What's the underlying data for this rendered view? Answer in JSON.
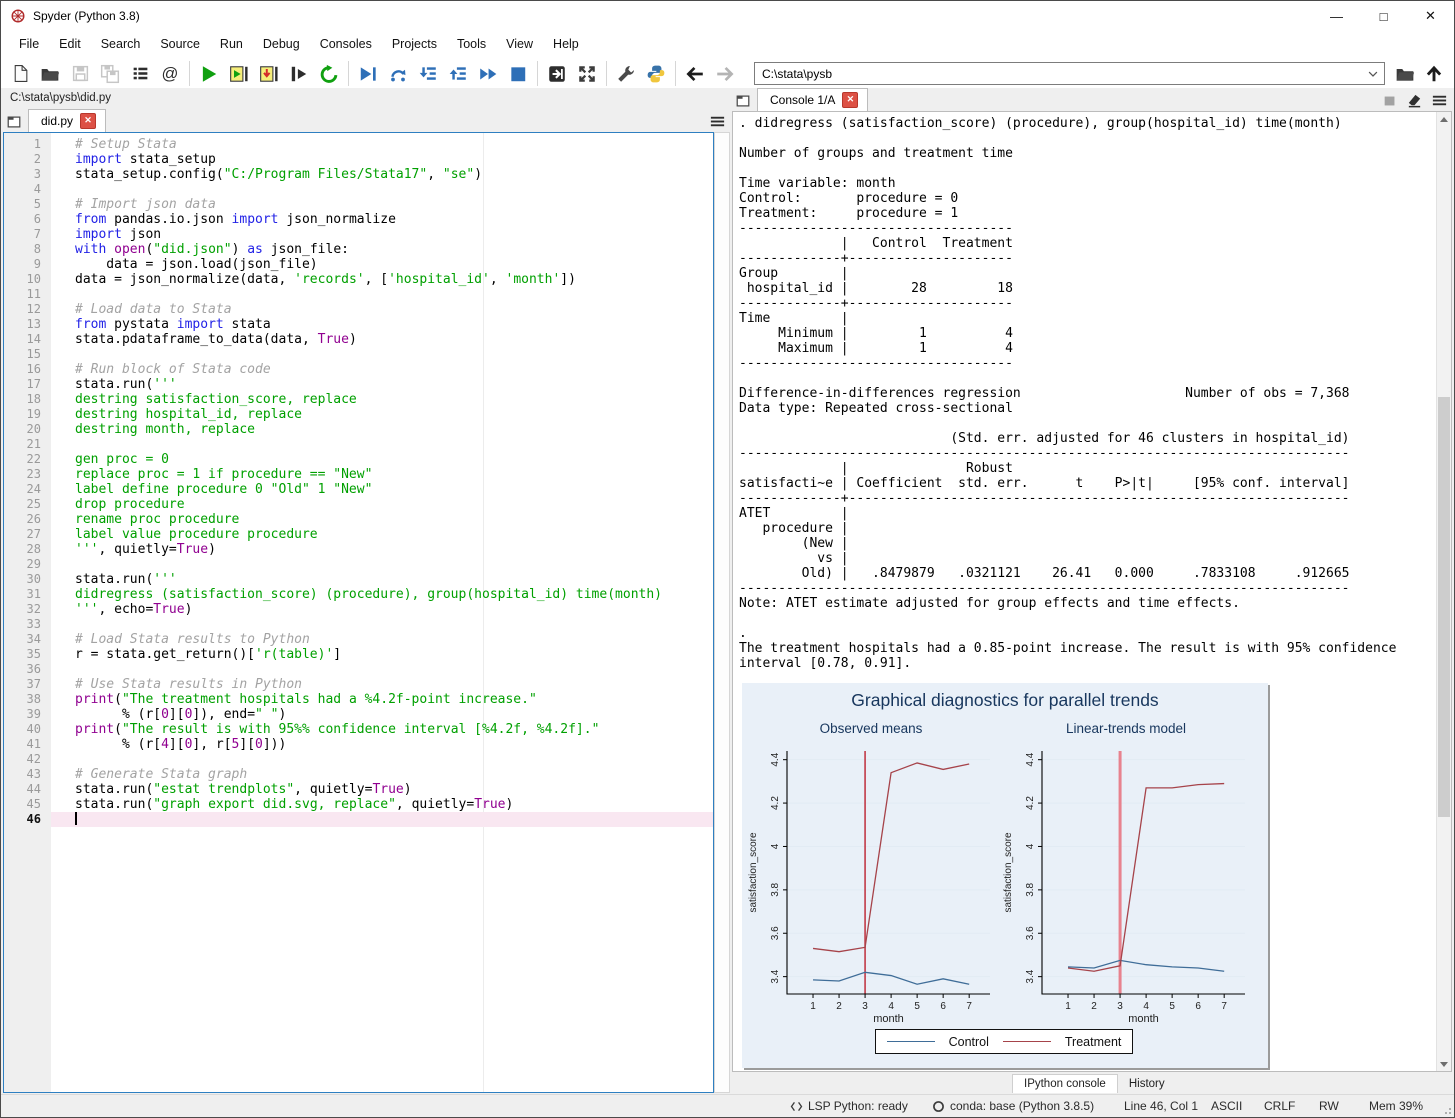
{
  "window": {
    "title": "Spyder (Python 3.8)",
    "controls": {
      "minimize": "—",
      "maximize": "□",
      "close": "✕"
    }
  },
  "menu": {
    "items": [
      "File",
      "Edit",
      "Search",
      "Source",
      "Run",
      "Debug",
      "Consoles",
      "Projects",
      "Tools",
      "View",
      "Help"
    ]
  },
  "toolbar": {
    "path_value": "C:\\stata\\pysb",
    "buttons": [
      {
        "id": "new-file"
      },
      {
        "id": "open-file"
      },
      {
        "id": "save-file",
        "enabled": false
      },
      {
        "id": "save-all",
        "enabled": false
      },
      {
        "id": "file-switcher"
      },
      {
        "id": "symbol-finder"
      },
      {
        "sep": true
      },
      {
        "id": "run-file"
      },
      {
        "id": "run-cell"
      },
      {
        "id": "run-cell-advance"
      },
      {
        "id": "run-selection"
      },
      {
        "id": "rerun-cell"
      },
      {
        "sep": true
      },
      {
        "id": "debug-file"
      },
      {
        "id": "step-over"
      },
      {
        "id": "step-into"
      },
      {
        "id": "step-return"
      },
      {
        "id": "debug-continue"
      },
      {
        "id": "stop-debug"
      },
      {
        "sep": true
      },
      {
        "id": "maximize-pane"
      },
      {
        "id": "fullscreen"
      },
      {
        "sep": true
      },
      {
        "id": "preferences"
      },
      {
        "id": "python-path"
      },
      {
        "sep": true
      },
      {
        "id": "back"
      },
      {
        "id": "forward",
        "enabled": false
      }
    ]
  },
  "editor": {
    "breadcrumb": "C:\\stata\\pysb\\did.py",
    "tab": "did.py",
    "lines": [
      {
        "n": 1,
        "tokens": [
          [
            "c",
            "# Setup Stata"
          ]
        ]
      },
      {
        "n": 2,
        "tokens": [
          [
            "k",
            "import"
          ],
          [
            "t",
            " stata_setup"
          ]
        ]
      },
      {
        "n": 3,
        "tokens": [
          [
            "t",
            "stata_setup.config("
          ],
          [
            "s",
            "\"C:/Program Files/Stata17\""
          ],
          [
            "t",
            ", "
          ],
          [
            "s",
            "\"se\""
          ],
          [
            "t",
            ")"
          ]
        ]
      },
      {
        "n": 4,
        "tokens": []
      },
      {
        "n": 5,
        "tokens": [
          [
            "c",
            "# Import json data"
          ]
        ]
      },
      {
        "n": 6,
        "tokens": [
          [
            "k",
            "from"
          ],
          [
            "t",
            " pandas.io.json "
          ],
          [
            "k",
            "import"
          ],
          [
            "t",
            " json_normalize"
          ]
        ]
      },
      {
        "n": 7,
        "tokens": [
          [
            "k",
            "import"
          ],
          [
            "t",
            " json"
          ]
        ]
      },
      {
        "n": 8,
        "tokens": [
          [
            "k",
            "with"
          ],
          [
            "t",
            " "
          ],
          [
            "m",
            "open"
          ],
          [
            "t",
            "("
          ],
          [
            "s",
            "\"did.json\""
          ],
          [
            "t",
            ") "
          ],
          [
            "k",
            "as"
          ],
          [
            "t",
            " json_file:"
          ]
        ]
      },
      {
        "n": 9,
        "tokens": [
          [
            "t",
            "    data = json.load(json_file)"
          ]
        ]
      },
      {
        "n": 10,
        "tokens": [
          [
            "t",
            "data = json_normalize(data, "
          ],
          [
            "s",
            "'records'"
          ],
          [
            "t",
            ", ["
          ],
          [
            "s",
            "'hospital_id'"
          ],
          [
            "t",
            ", "
          ],
          [
            "s",
            "'month'"
          ],
          [
            "t",
            "])"
          ]
        ]
      },
      {
        "n": 11,
        "tokens": []
      },
      {
        "n": 12,
        "tokens": [
          [
            "c",
            "# Load data to Stata"
          ]
        ]
      },
      {
        "n": 13,
        "tokens": [
          [
            "k",
            "from"
          ],
          [
            "t",
            " pystata "
          ],
          [
            "k",
            "import"
          ],
          [
            "t",
            " stata"
          ]
        ]
      },
      {
        "n": 14,
        "tokens": [
          [
            "t",
            "stata.pdataframe_to_data(data, "
          ],
          [
            "m",
            "True"
          ],
          [
            "t",
            ")"
          ]
        ]
      },
      {
        "n": 15,
        "tokens": []
      },
      {
        "n": 16,
        "tokens": [
          [
            "c",
            "# Run block of Stata code"
          ]
        ]
      },
      {
        "n": 17,
        "tokens": [
          [
            "t",
            "stata.run("
          ],
          [
            "s",
            "'''"
          ]
        ]
      },
      {
        "n": 18,
        "tokens": [
          [
            "s",
            "destring satisfaction_score, replace"
          ]
        ]
      },
      {
        "n": 19,
        "tokens": [
          [
            "s",
            "destring hospital_id, replace"
          ]
        ]
      },
      {
        "n": 20,
        "tokens": [
          [
            "s",
            "destring month, replace"
          ]
        ]
      },
      {
        "n": 21,
        "tokens": []
      },
      {
        "n": 22,
        "tokens": [
          [
            "s",
            "gen proc = 0"
          ]
        ]
      },
      {
        "n": 23,
        "tokens": [
          [
            "s",
            "replace proc = 1 if procedure == \"New\""
          ]
        ]
      },
      {
        "n": 24,
        "tokens": [
          [
            "s",
            "label define procedure 0 \"Old\" 1 \"New\""
          ]
        ]
      },
      {
        "n": 25,
        "tokens": [
          [
            "s",
            "drop procedure"
          ]
        ]
      },
      {
        "n": 26,
        "tokens": [
          [
            "s",
            "rename proc procedure"
          ]
        ]
      },
      {
        "n": 27,
        "tokens": [
          [
            "s",
            "label value procedure procedure"
          ]
        ]
      },
      {
        "n": 28,
        "tokens": [
          [
            "s",
            "'''"
          ],
          [
            "t",
            ", quietly="
          ],
          [
            "m",
            "True"
          ],
          [
            "t",
            ")"
          ]
        ]
      },
      {
        "n": 29,
        "tokens": []
      },
      {
        "n": 30,
        "tokens": [
          [
            "t",
            "stata.run("
          ],
          [
            "s",
            "'''"
          ]
        ]
      },
      {
        "n": 31,
        "tokens": [
          [
            "s",
            "didregress (satisfaction_score) (procedure), group(hospital_id) time(month)"
          ]
        ]
      },
      {
        "n": 32,
        "tokens": [
          [
            "s",
            "'''"
          ],
          [
            "t",
            ", echo="
          ],
          [
            "m",
            "True"
          ],
          [
            "t",
            ")"
          ]
        ]
      },
      {
        "n": 33,
        "tokens": []
      },
      {
        "n": 34,
        "tokens": [
          [
            "c",
            "# Load Stata results to Python"
          ]
        ]
      },
      {
        "n": 35,
        "tokens": [
          [
            "t",
            "r = stata.get_return()["
          ],
          [
            "s",
            "'r(table)'"
          ],
          [
            "t",
            "]"
          ]
        ]
      },
      {
        "n": 36,
        "tokens": []
      },
      {
        "n": 37,
        "tokens": [
          [
            "c",
            "# Use Stata results in Python"
          ]
        ]
      },
      {
        "n": 38,
        "tokens": [
          [
            "m",
            "print"
          ],
          [
            "t",
            "("
          ],
          [
            "s",
            "\"The treatment hospitals had a %4.2f-point increase.\""
          ]
        ]
      },
      {
        "n": 39,
        "tokens": [
          [
            "t",
            "      % (r["
          ],
          [
            "m",
            "0"
          ],
          [
            "t",
            "]["
          ],
          [
            "m",
            "0"
          ],
          [
            "t",
            "]), end="
          ],
          [
            "s",
            "\" \""
          ],
          [
            "t",
            ")"
          ]
        ]
      },
      {
        "n": 40,
        "tokens": [
          [
            "m",
            "print"
          ],
          [
            "t",
            "("
          ],
          [
            "s",
            "\"The result is with 95%% confidence interval [%4.2f, %4.2f].\""
          ]
        ]
      },
      {
        "n": 41,
        "tokens": [
          [
            "t",
            "      % (r["
          ],
          [
            "m",
            "4"
          ],
          [
            "t",
            "]["
          ],
          [
            "m",
            "0"
          ],
          [
            "t",
            "], r["
          ],
          [
            "m",
            "5"
          ],
          [
            "t",
            "]["
          ],
          [
            "m",
            "0"
          ],
          [
            "t",
            "]))"
          ]
        ]
      },
      {
        "n": 42,
        "tokens": []
      },
      {
        "n": 43,
        "tokens": [
          [
            "c",
            "# Generate Stata graph"
          ]
        ]
      },
      {
        "n": 44,
        "tokens": [
          [
            "t",
            "stata.run("
          ],
          [
            "s",
            "\"estat trendplots\""
          ],
          [
            "t",
            ", quietly="
          ],
          [
            "m",
            "True"
          ],
          [
            "t",
            ")"
          ]
        ]
      },
      {
        "n": 45,
        "tokens": [
          [
            "t",
            "stata.run("
          ],
          [
            "s",
            "\"graph export did.svg, replace\""
          ],
          [
            "t",
            ", quietly="
          ],
          [
            "m",
            "True"
          ],
          [
            "t",
            ")"
          ]
        ]
      },
      {
        "n": 46,
        "tokens": [],
        "active": true
      }
    ]
  },
  "console": {
    "tab": "Console 1/A",
    "lines": [
      ". didregress (satisfaction_score) (procedure), group(hospital_id) time(month)",
      "",
      "Number of groups and treatment time",
      "",
      "Time variable: month",
      "Control:       procedure = 0",
      "Treatment:     procedure = 1",
      "-----------------------------------",
      "             |   Control  Treatment",
      "-------------+---------------------",
      "Group        |",
      " hospital_id |        28         18",
      "-------------+---------------------",
      "Time         |",
      "     Minimum |         1          4",
      "     Maximum |         1          4",
      "-----------------------------------",
      "",
      "Difference-in-differences regression                     Number of obs = 7,368",
      "Data type: Repeated cross-sectional",
      "",
      "                           (Std. err. adjusted for 46 clusters in hospital_id)",
      "------------------------------------------------------------------------------",
      "             |               Robust",
      "satisfacti~e | Coefficient  std. err.      t    P>|t|     [95% conf. interval]",
      "-------------+----------------------------------------------------------------",
      "ATET         |",
      "   procedure |",
      "        (New |",
      "          vs |",
      "        Old) |   .8479879   .0321121    26.41   0.000     .7833108     .912665",
      "------------------------------------------------------------------------------",
      "Note: ATET estimate adjusted for group effects and time effects.",
      "",
      ".",
      "The treatment hospitals had a 0.85-point increase. The result is with 95% confidence",
      "interval [0.78, 0.91]."
    ]
  },
  "chart_data": {
    "type": "line",
    "title": "Graphical diagnostics for parallel trends",
    "xlabel": "month",
    "ylabel": "satisfaction_score",
    "x": [
      1,
      2,
      3,
      4,
      5,
      6,
      7
    ],
    "xticks": [
      1,
      2,
      3,
      4,
      5,
      6,
      7
    ],
    "yticks": [
      3.4,
      3.6,
      3.8,
      4,
      4.2,
      4.4
    ],
    "x_range": [
      0,
      7.8
    ],
    "y_range": [
      3.32,
      4.44
    ],
    "grid": true,
    "legend_position": "bottom",
    "legend": [
      "Control",
      "Treatment"
    ],
    "series_colors": {
      "Control": "#3f6d98",
      "Treatment": "#a6434a"
    },
    "background": "#e9f0f8",
    "panels": [
      {
        "title": "Observed means",
        "vline_x": 3,
        "vline_color": "#c23a47",
        "vline_width": 1.6,
        "series": [
          {
            "name": "Control",
            "values": [
              3.385,
              3.38,
              3.42,
              3.405,
              3.365,
              3.39,
              3.365
            ]
          },
          {
            "name": "Treatment",
            "values": [
              3.53,
              3.515,
              3.535,
              4.34,
              4.385,
              4.355,
              4.38
            ]
          }
        ]
      },
      {
        "title": "Linear-trends model",
        "vline_x": 3,
        "vline_color": "#e8828e",
        "vline_width": 3,
        "series": [
          {
            "name": "Control",
            "values": [
              3.445,
              3.44,
              3.475,
              3.455,
              3.445,
              3.44,
              3.425
            ]
          },
          {
            "name": "Treatment",
            "values": [
              3.44,
              3.425,
              3.45,
              4.27,
              4.27,
              4.285,
              4.29
            ]
          }
        ]
      }
    ]
  },
  "bottom_tabs": {
    "ipython": "IPython console",
    "history": "History"
  },
  "statusbar": {
    "lsp": "LSP Python: ready",
    "conda": "conda: base (Python 3.8.5)",
    "cursor": "Line 46, Col 1",
    "encoding": "ASCII",
    "eol": "CRLF",
    "permissions": "RW",
    "memory": "Mem 39%"
  }
}
